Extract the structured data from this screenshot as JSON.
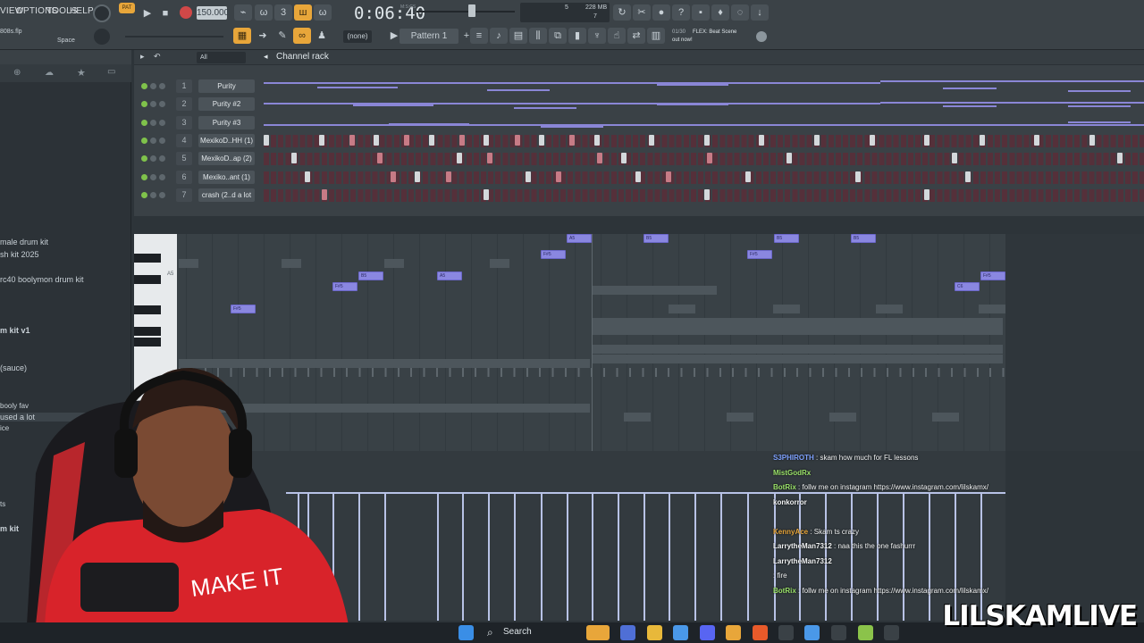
{
  "menu": {
    "view": "VIEW",
    "options": "OPTIONS",
    "tools": "TOOLS",
    "help": "HELP"
  },
  "transport": {
    "pat": "PAT",
    "tempo": "150.000",
    "time": "0:06:40",
    "time_unit": "M:S:CS",
    "cpu": "5",
    "ram": "228 MB",
    "ram_sub": "7"
  },
  "project": {
    "file": "808s.flp",
    "hint": "Space"
  },
  "toolbar2": {
    "snap": "(none)",
    "pattern": "Pattern 1",
    "news_count": "01/30",
    "news": "FLEX: Beat Scene",
    "news2": "out now!"
  },
  "channel_rack": {
    "title": "Channel rack",
    "filter": "All",
    "channels": [
      {
        "num": "1",
        "name": "Purity"
      },
      {
        "num": "2",
        "name": "Purity #2"
      },
      {
        "num": "3",
        "name": "Purity #3"
      },
      {
        "num": "4",
        "name": "MexikoD..HH (1)"
      },
      {
        "num": "5",
        "name": "MexikoD..ap (2)"
      },
      {
        "num": "6",
        "name": "Mexiko..ant (1)"
      },
      {
        "num": "7",
        "name": "crash (2..d a lot"
      }
    ],
    "add": "+"
  },
  "browser": {
    "items": [
      "male drum kit",
      "sh kit 2025",
      "rc40 boolymon drum kit",
      "m kit v1",
      "(sauce)",
      "booly fav",
      "used a lot",
      "ice",
      "ts",
      "m kit"
    ]
  },
  "piano_roll": {
    "key_label": "A5",
    "notes": [
      "F#5",
      "F#5",
      "B5",
      "A5",
      "F#5",
      "A5",
      "B5",
      "F#5",
      "B5",
      "B5",
      "C6",
      "F#5"
    ]
  },
  "chat": [
    {
      "user": "S3PHIROTH",
      "msg": "skam how much for FL lessons",
      "color": "#7fa2ff"
    },
    {
      "user": "MistGodRx",
      "msg": "",
      "color": "#9be36a"
    },
    {
      "user": "BotRix",
      "msg": "follw me on instagram https://www.instagram.com/lilskamx/",
      "color": "#9be36a"
    },
    {
      "user": "konkorror",
      "msg": "",
      "color": "#f2f4f5"
    },
    {
      "user": "",
      "msg": "",
      "color": "#e84a4a"
    },
    {
      "user": "KennyAce",
      "msg": "Skam ts crazy",
      "color": "#e8a63a"
    },
    {
      "user": "LarrytheMan7312",
      "msg": "naa this the one fashurrr",
      "color": "#f2f4f5"
    },
    {
      "user": "LarrytheMan7312",
      "msg": "",
      "color": "#f2f4f5"
    },
    {
      "user": "",
      "msg": "fire",
      "color": "#e84a4a"
    },
    {
      "user": "BotRix",
      "msg": "follw me on instagram https://www.instagram.com/lilskamx/",
      "color": "#9be36a"
    }
  ],
  "webcam": {
    "shirt_text": "MAKE IT"
  },
  "taskbar": {
    "search": "Search"
  },
  "watermark": "LILSKAMLIVE",
  "colors": {
    "accent": "#e8a63a",
    "note": "#8a87e0",
    "step_on": "#d3d8db",
    "step_red": "#c77b86"
  }
}
